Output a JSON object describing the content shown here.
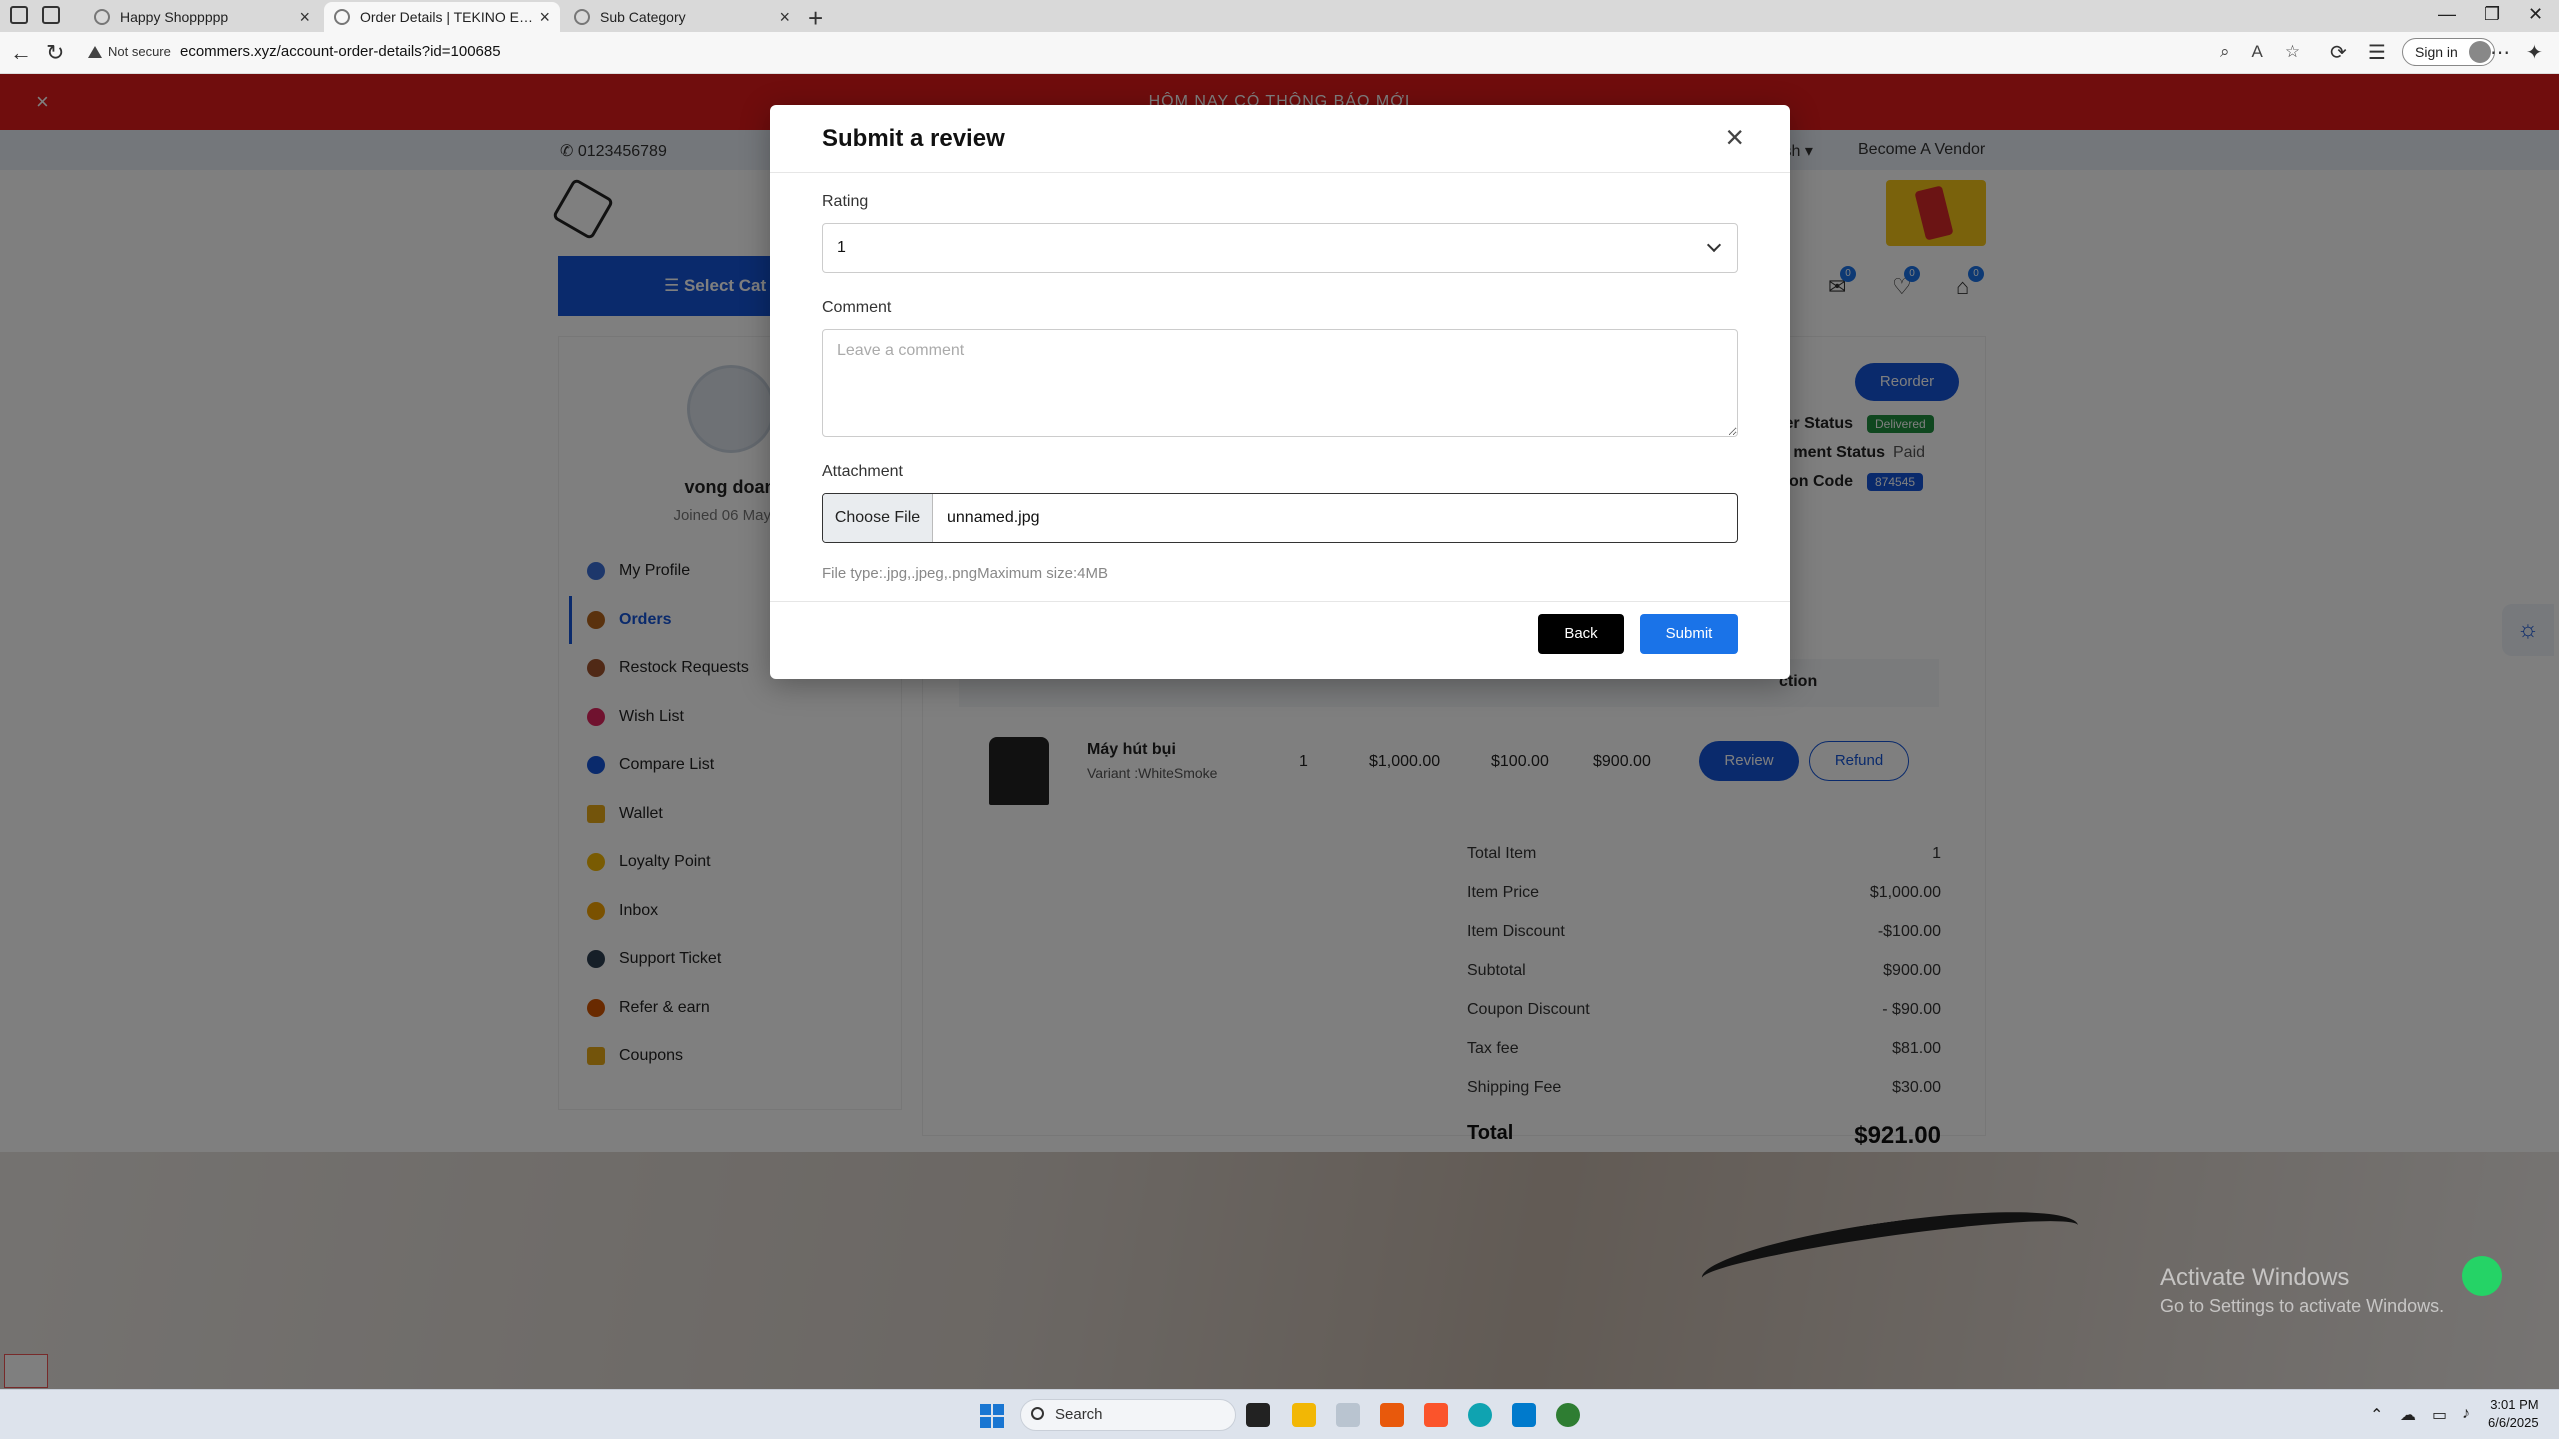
{
  "browser": {
    "tabs": [
      {
        "label": "Happy Shoppppp",
        "active": false
      },
      {
        "label": "Order Details | TEKINO Ecommerce",
        "active": true
      },
      {
        "label": "Sub Category",
        "active": false
      }
    ],
    "security_label": "Not secure",
    "url": "ecommers.xyz/account-order-details?id=100685",
    "signin_label": "Sign in"
  },
  "page": {
    "announcement": "HÔM NAY CÓ THÔNG BÁO MỚI",
    "phone": "0123456789",
    "language": "ish",
    "become_vendor": "Become A Vendor",
    "category_label": "Select Cat",
    "header_counts": {
      "messages": "0",
      "wishlist": "0",
      "cart": "0"
    },
    "profile": {
      "name": "vong doan",
      "joined": "Joined 06 May, 2"
    },
    "menu": [
      {
        "label": "My Profile",
        "color": "#3b6fd6"
      },
      {
        "label": "Orders",
        "color": "#b5651d",
        "active": true
      },
      {
        "label": "Restock Requests",
        "color": "#a0522d"
      },
      {
        "label": "Wish List",
        "color": "#e0245e"
      },
      {
        "label": "Compare List",
        "color": "#1455d9"
      },
      {
        "label": "Wallet",
        "color": "#e6a817"
      },
      {
        "label": "Loyalty Point",
        "color": "#f2b705"
      },
      {
        "label": "Inbox",
        "color": "#f4a300"
      },
      {
        "label": "Support Ticket",
        "color": "#2c3e50"
      },
      {
        "label": "Refer & earn",
        "color": "#d35400"
      },
      {
        "label": "Coupons",
        "color": "#e6a817"
      }
    ],
    "order": {
      "reorder_label": "Reorder",
      "order_status_label": "er Status",
      "order_status_value": "Delivered",
      "payment_status_label": "ment Status",
      "payment_status_value": "Paid",
      "verification_label": "fication Code",
      "verification_value": "874545",
      "action_header": "ction",
      "item": {
        "name": "Máy hút bụi",
        "variant": "Variant :WhiteSmoke",
        "qty": "1",
        "price": "$1,000.00",
        "discount": "$100.00",
        "total": "$900.00",
        "review_label": "Review",
        "refund_label": "Refund"
      },
      "summary": [
        {
          "label": "Total Item",
          "value": "1"
        },
        {
          "label": "Item Price",
          "value": "$1,000.00"
        },
        {
          "label": "Item Discount",
          "value": "-$100.00"
        },
        {
          "label": "Subtotal",
          "value": "$900.00"
        },
        {
          "label": "Coupon Discount",
          "value": "- $90.00"
        },
        {
          "label": "Tax fee",
          "value": "$81.00"
        },
        {
          "label": "Shipping Fee",
          "value": "$30.00"
        }
      ],
      "grand_total_label": "Total",
      "grand_total_value": "$921.00"
    },
    "watermark": {
      "line1": "Activate Windows",
      "line2": "Go to Settings to activate Windows."
    }
  },
  "modal": {
    "title": "Submit a review",
    "rating_label": "Rating",
    "rating_value": "1",
    "comment_label": "Comment",
    "comment_placeholder": "Leave a comment",
    "attachment_label": "Attachment",
    "choose_file_label": "Choose File",
    "file_name": "unnamed.jpg",
    "hint": "File type:.jpg,.jpeg,.pngMaximum size:4MB",
    "back_label": "Back",
    "submit_label": "Submit"
  },
  "taskbar": {
    "search_label": "Search",
    "time": "3:01 PM",
    "date": "6/6/2025"
  },
  "colors": {
    "primary": "#1455d9",
    "announcement": "#e01a1a",
    "submit": "#1a73e8",
    "delivered": "#1e8e3e"
  }
}
